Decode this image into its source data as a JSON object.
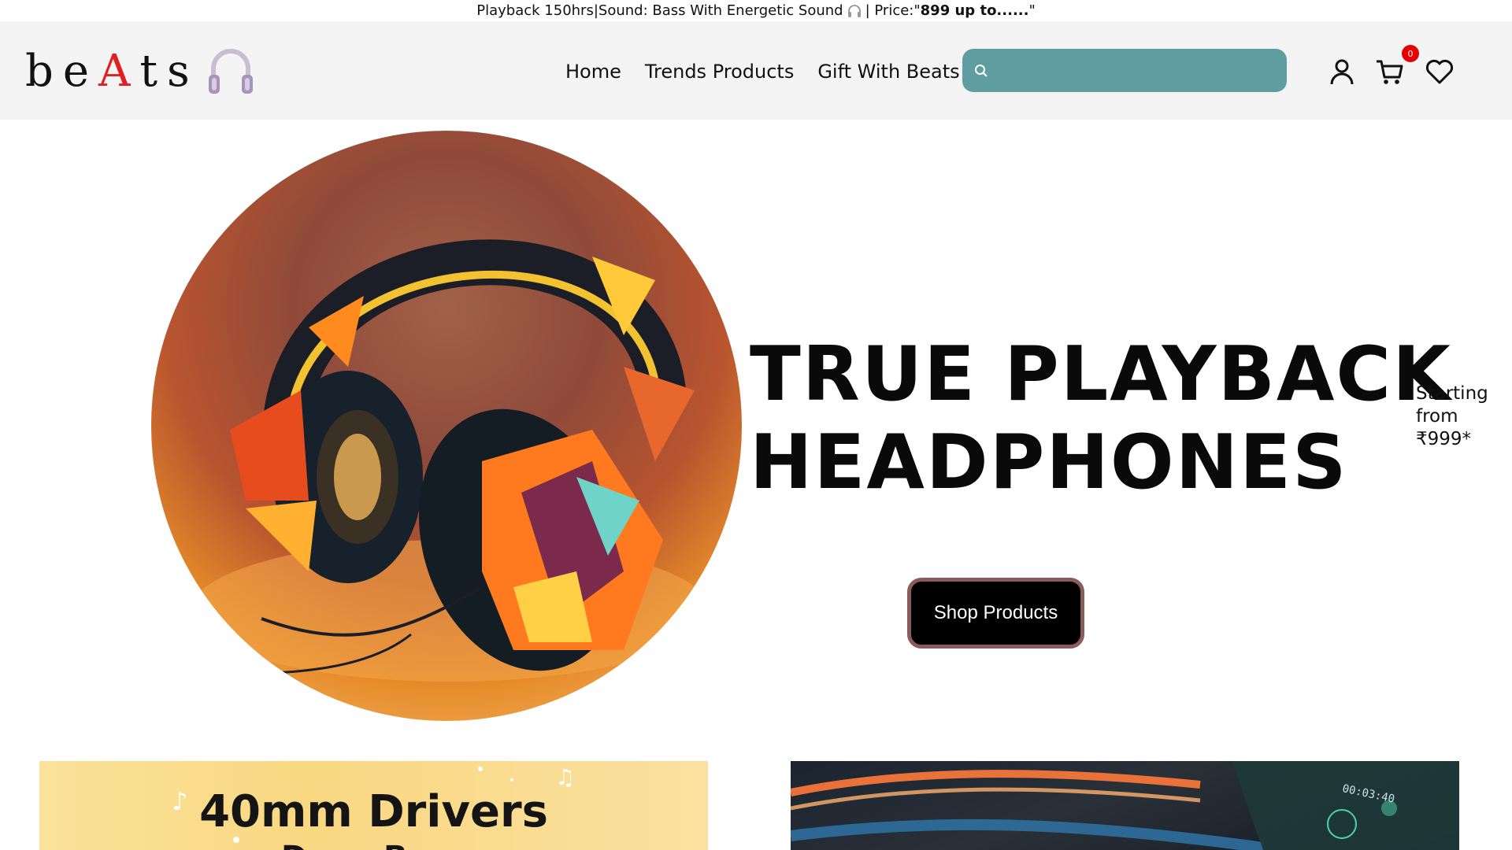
{
  "announcement": {
    "part1": "Playback 150hrs|Sound: Bass With Energetic Sound",
    "part2": " | Price:\"",
    "bold": "899 up to......",
    "part3": "\""
  },
  "logo": {
    "prefix": "be",
    "accent": "A",
    "suffix": "ts",
    "icon": "headphones-icon",
    "accent_color": "#e31e1e"
  },
  "nav": {
    "links": [
      "Home",
      "Trends Products",
      "Gift With Beats"
    ]
  },
  "search": {
    "placeholder": "",
    "value": "",
    "icon": "search-icon",
    "color": "#5e9ea0"
  },
  "icons": {
    "user": "user-icon",
    "cart": "cart-icon",
    "heart": "heart-icon"
  },
  "cart": {
    "count": "0"
  },
  "hero": {
    "title_line1": "TRUE PLAYBACK",
    "title_line2": "HEADPHONES",
    "starting_label": "Starting from",
    "price": "₹999*",
    "cta": "Shop Products"
  },
  "banners": {
    "left_title": "40mm Drivers",
    "left_sub": "Deep Bass",
    "right_timer": "00:03:40"
  }
}
